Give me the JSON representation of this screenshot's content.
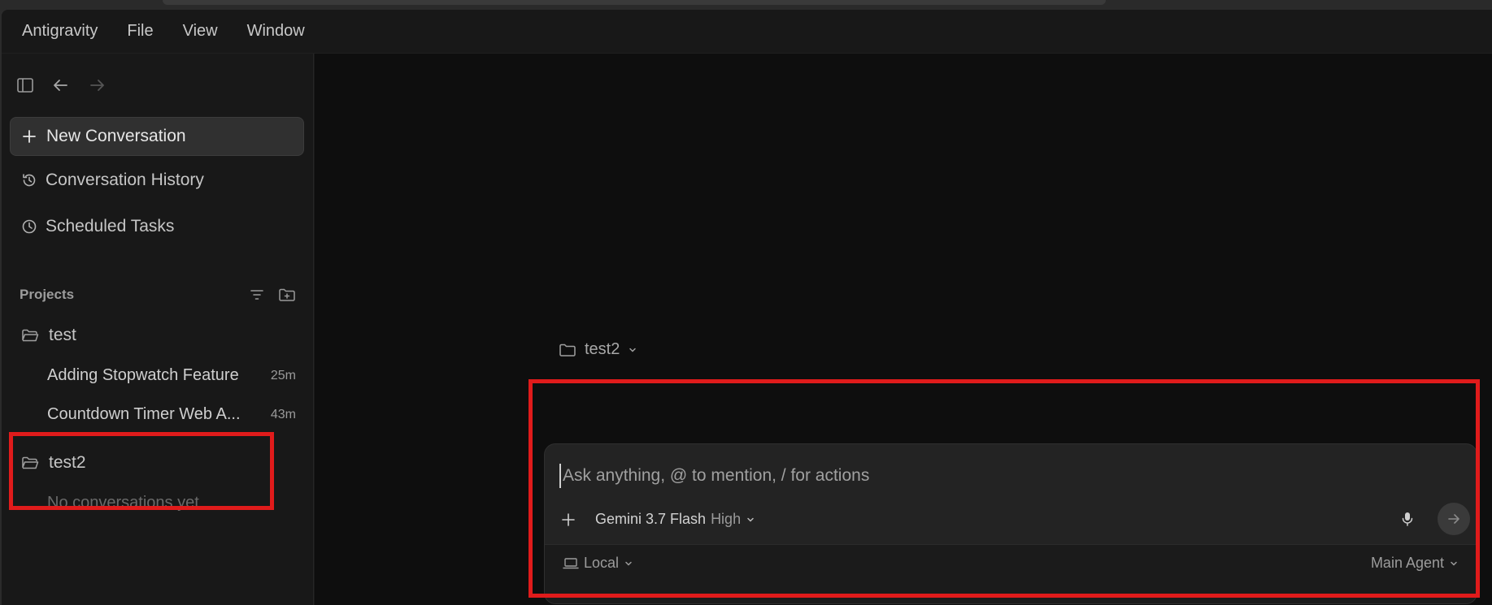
{
  "menubar": {
    "items": [
      "Antigravity",
      "File",
      "View",
      "Window"
    ]
  },
  "sidebar": {
    "new_conversation": "New Conversation",
    "nav": [
      {
        "label": "Conversation History",
        "icon": "history-icon"
      },
      {
        "label": "Scheduled Tasks",
        "icon": "clock-icon"
      }
    ],
    "projects_title": "Projects",
    "projects": [
      {
        "name": "test",
        "conversations": [
          {
            "title": "Adding Stopwatch Feature",
            "age": "25m"
          },
          {
            "title": "Countdown Timer Web A...",
            "age": "43m"
          }
        ]
      },
      {
        "name": "test2",
        "empty_text": "No conversations yet"
      }
    ]
  },
  "composer": {
    "workspace": "test2",
    "placeholder": "Ask anything, @ to mention, / for actions",
    "model_name": "Gemini 3.7 Flash",
    "model_level": "High",
    "mode": "Local",
    "agent": "Main Agent"
  },
  "colors": {
    "highlight_box": "#e01b1b"
  }
}
